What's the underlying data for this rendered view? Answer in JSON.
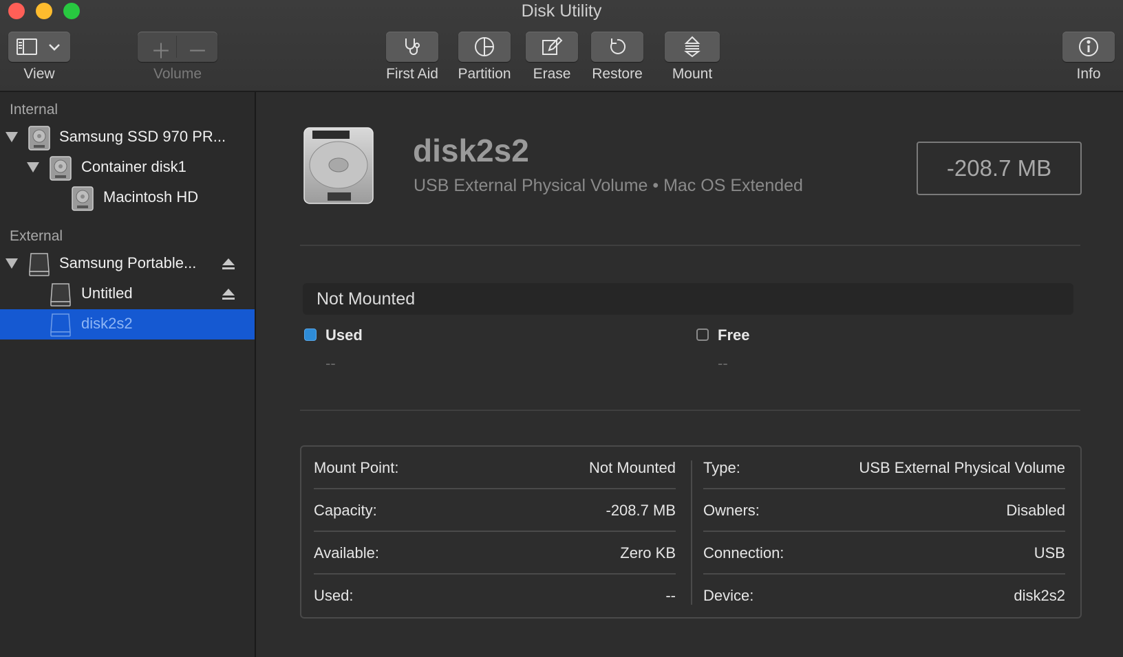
{
  "window": {
    "title": "Disk Utility"
  },
  "toolbar": {
    "view_label": "View",
    "volume_label": "Volume",
    "first_aid_label": "First Aid",
    "partition_label": "Partition",
    "erase_label": "Erase",
    "restore_label": "Restore",
    "mount_label": "Mount",
    "info_label": "Info"
  },
  "sidebar": {
    "internal_header": "Internal",
    "external_header": "External",
    "items": [
      {
        "label": "Samsung SSD 970 PR..."
      },
      {
        "label": "Container disk1"
      },
      {
        "label": "Macintosh HD"
      },
      {
        "label": "Samsung Portable..."
      },
      {
        "label": "Untitled"
      },
      {
        "label": "disk2s2"
      }
    ]
  },
  "main": {
    "disk_name": "disk2s2",
    "disk_subtitle": "USB External Physical Volume • Mac OS Extended",
    "capacity": "-208.7 MB",
    "status": "Not Mounted",
    "legend": {
      "used_title": "Used",
      "used_value": "--",
      "free_title": "Free",
      "free_value": "--"
    },
    "info_left": [
      {
        "key": "Mount Point:",
        "value": "Not Mounted"
      },
      {
        "key": "Capacity:",
        "value": "-208.7 MB"
      },
      {
        "key": "Available:",
        "value": "Zero KB"
      },
      {
        "key": "Used:",
        "value": "--"
      }
    ],
    "info_right": [
      {
        "key": "Type:",
        "value": "USB External Physical Volume"
      },
      {
        "key": "Owners:",
        "value": "Disabled"
      },
      {
        "key": "Connection:",
        "value": "USB"
      },
      {
        "key": "Device:",
        "value": "disk2s2"
      }
    ]
  },
  "colors": {
    "selection": "#1559d2",
    "used_swatch": "#2e8cd8",
    "background": "#2d2d2d"
  }
}
